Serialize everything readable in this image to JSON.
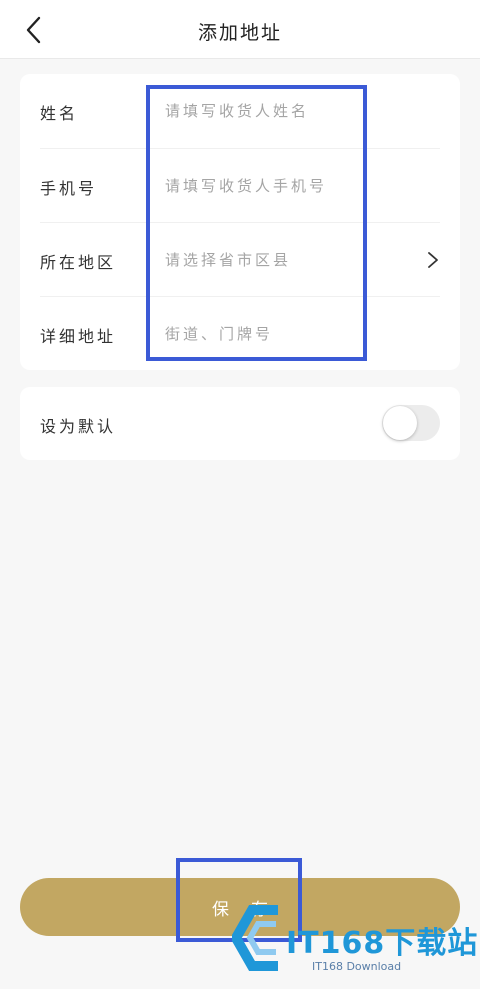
{
  "header": {
    "title": "添加地址",
    "back_icon": "chevron-left-icon"
  },
  "form": {
    "fields": [
      {
        "label": "姓名",
        "placeholder": "请填写收货人姓名",
        "value": ""
      },
      {
        "label": "手机号",
        "placeholder": "请填写收货人手机号",
        "value": ""
      },
      {
        "label": "所在地区",
        "placeholder": "请选择省市区县",
        "value": "",
        "icon": "chevron-right-icon"
      },
      {
        "label": "详细地址",
        "placeholder": "街道、门牌号",
        "value": ""
      }
    ]
  },
  "default_setting": {
    "label": "设为默认",
    "enabled": false
  },
  "save_button": {
    "label": "保存"
  },
  "watermark": {
    "main": "IT168下载站",
    "sub": "IT168 Download"
  },
  "colors": {
    "accent": "#c2a762",
    "highlight": "#3b5ad6",
    "background": "#f7f7f7",
    "placeholder": "#a5a5a5",
    "watermark": "#1f97d8"
  }
}
